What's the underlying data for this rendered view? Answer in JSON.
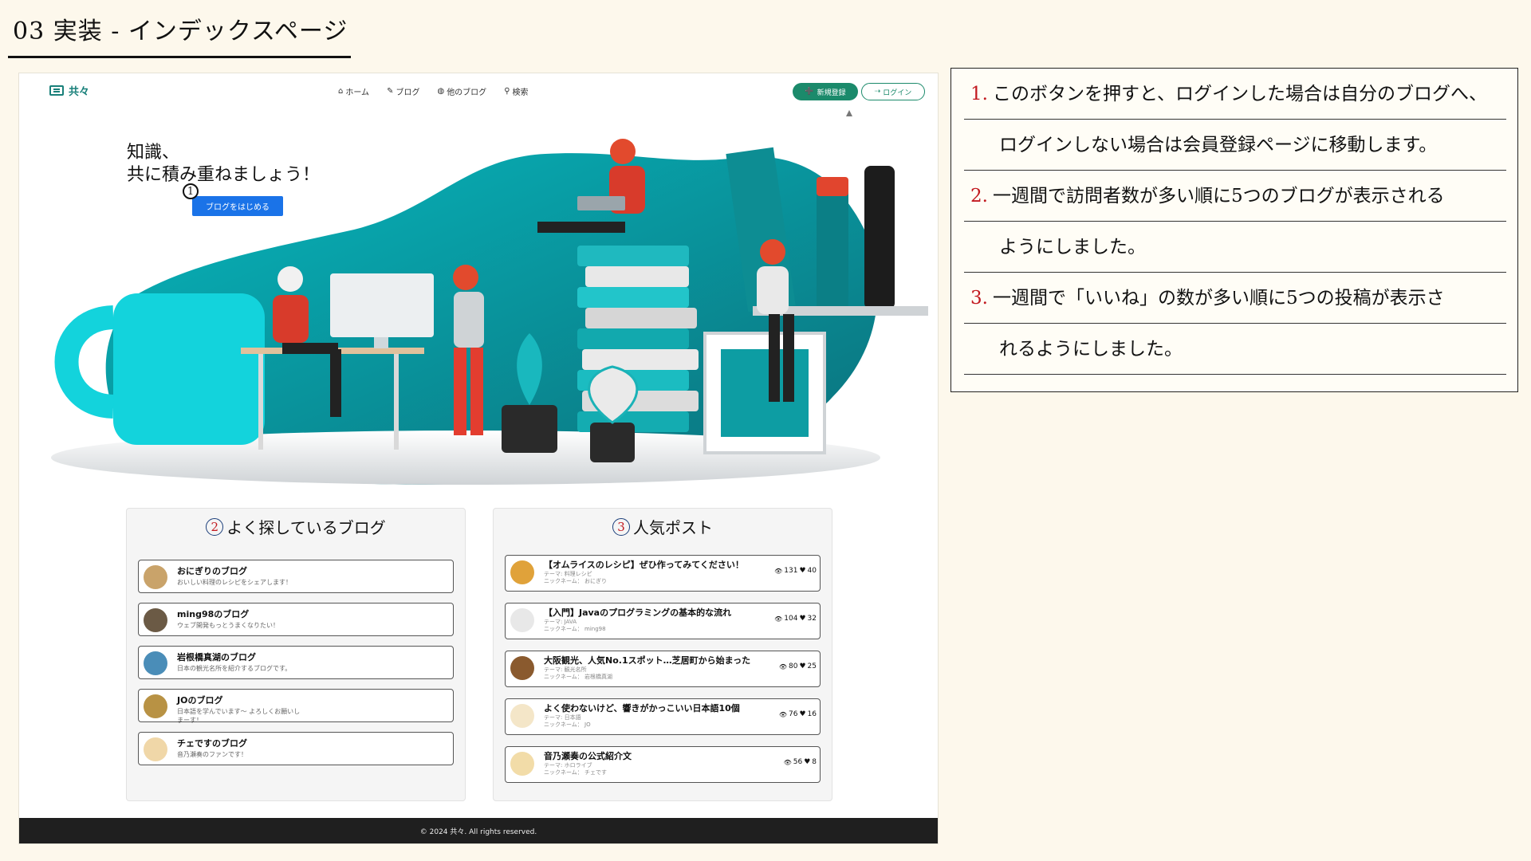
{
  "slide": {
    "title": "03 実装 - インデックスページ"
  },
  "site": {
    "brand": "共々",
    "nav": [
      {
        "icon": "home-icon",
        "glyph": "⌂",
        "label": "ホーム"
      },
      {
        "icon": "blog-icon",
        "glyph": "✎",
        "label": "ブログ"
      },
      {
        "icon": "globe-icon",
        "glyph": "◍",
        "label": "他のブログ"
      },
      {
        "icon": "search-icon",
        "glyph": "⚲",
        "label": "検索"
      }
    ],
    "signup_label": "新規登録",
    "login_label": "ログイン"
  },
  "hero": {
    "line1": "知識、",
    "line2": "共に積み重ねましょう！",
    "marker": "1",
    "cta_label": "ブログをはじめる"
  },
  "blogs": {
    "marker": "2",
    "title": "よく探しているブログ",
    "items": [
      {
        "title": "おにぎりのブログ",
        "desc": "おいしい料理のレシピをシェアします！",
        "avatar_color": "#c9a36a"
      },
      {
        "title": "ming98のブログ",
        "desc": "ウェブ開発もっとうまくなりたい！",
        "avatar_color": "#6b5a45"
      },
      {
        "title": "岩根橋真湖のブログ",
        "desc": "日本の観光名所を紹介するブログです。",
        "avatar_color": "#4a8db8"
      },
      {
        "title": "JOのブログ",
        "desc": "日本語を学んでいます〜 よろしくお願いしまーす！",
        "avatar_color": "#b89244"
      },
      {
        "title": "チェですのブログ",
        "desc": "音乃瀬奏のファンです！",
        "avatar_color": "#f0d7a8"
      }
    ]
  },
  "posts": {
    "marker": "3",
    "title": "人気ポスト",
    "items": [
      {
        "title": "【オムライスのレシピ】ぜひ作ってみてください！",
        "theme": "テーマ: 料理レシピ",
        "nick": "ニックネーム： おにぎり",
        "views": "131",
        "likes": "40",
        "avatar_color": "#e0a23a"
      },
      {
        "title": "【入門】Javaのプログラミングの基本的な流れ",
        "theme": "テーマ: JAVA",
        "nick": "ニックネーム： ming98",
        "views": "104",
        "likes": "32",
        "avatar_color": "#e8e8e8"
      },
      {
        "title": "大阪観光、人気No.1スポット…芝居町から始まった",
        "theme": "テーマ: 観光名所",
        "nick": "ニックネーム： 岩根橋真湖",
        "views": "80",
        "likes": "25",
        "avatar_color": "#8a5a2e"
      },
      {
        "title": "よく使わないけど、響きがかっこいい日本語10個",
        "theme": "テーマ: 日本語",
        "nick": "ニックネーム： JO",
        "views": "76",
        "likes": "16",
        "avatar_color": "#f4e6c8"
      },
      {
        "title": "音乃瀬奏の公式紹介文",
        "theme": "テーマ: ホロライブ",
        "nick": "ニックネーム： チェです",
        "views": "56",
        "likes": "8",
        "avatar_color": "#f2dca8"
      }
    ],
    "view_glyph": "👁",
    "like_glyph": "♥"
  },
  "footer": "© 2024 共々. All rights reserved.",
  "notes": [
    {
      "num": "1.",
      "text": "このボタンを押すと、ログインした場合は自分のブログへ、"
    },
    {
      "num": "",
      "text": "ログインしない場合は会員登録ページに移動します。"
    },
    {
      "num": "2.",
      "text": "一週間で訪問者数が多い順に5つのブログが表示される"
    },
    {
      "num": "",
      "text": "ようにしました。"
    },
    {
      "num": "3.",
      "text": "一週間で「いいね」の数が多い順に5つの投稿が表示さ"
    },
    {
      "num": "",
      "text": "れるようにしました。"
    }
  ],
  "colors": {
    "accent": "#1b8a6b",
    "cta": "#1a73e8",
    "teal": "#0aa3a8",
    "marker_red": "#c2191f"
  }
}
